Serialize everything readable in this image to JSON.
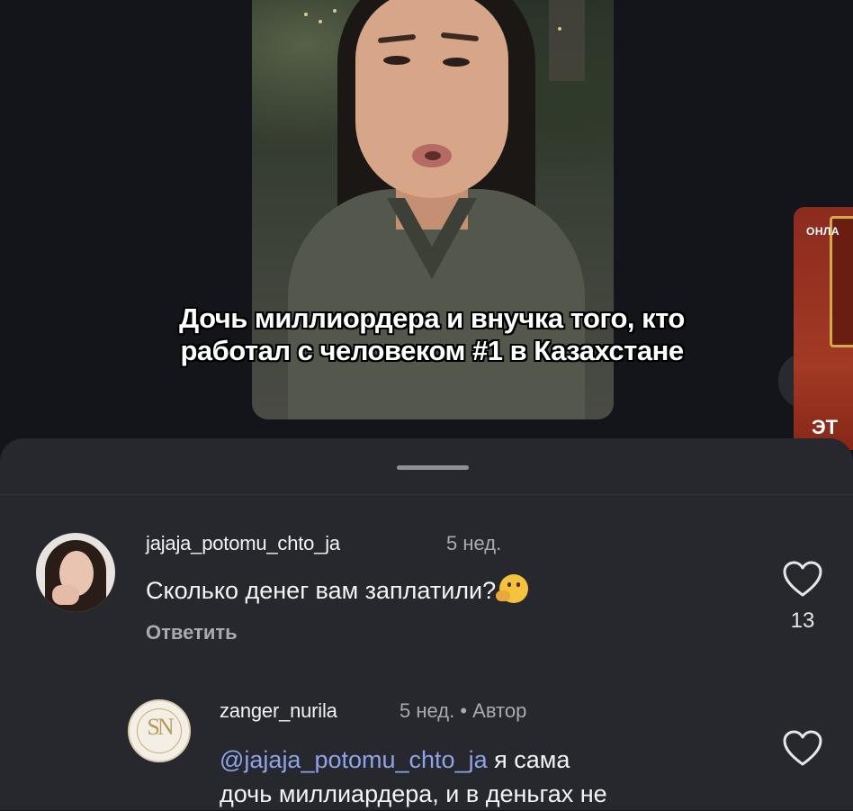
{
  "video": {
    "caption": "Дочь миллиордера и внучка того, кто работал с человеком #1 в Казахстане",
    "next_preview": {
      "top_label": "ОНЛА",
      "bottom_label": "ЭТ"
    }
  },
  "comments": [
    {
      "username": "jajaja_potomu_chto_ja",
      "time": "5 нед.",
      "text": "Сколько денег вам заплатили?",
      "emoji_icon": "thinking-face-icon",
      "reply_label": "Ответить",
      "like_count": "13"
    },
    {
      "username": "zanger_nurila",
      "time": "5 нед.",
      "separator": "•",
      "author_badge": "Автор",
      "mention": "@jajaja_potomu_chto_ja",
      "text_line1": "я сама",
      "text_line2": "дочь миллиардера, и в деньгах не",
      "avatar_monogram": "SN"
    }
  ],
  "colors": {
    "background": "#13151a",
    "sheet": "#26282d",
    "mention": "#8fa3e8",
    "muted": "#a8aab0"
  }
}
